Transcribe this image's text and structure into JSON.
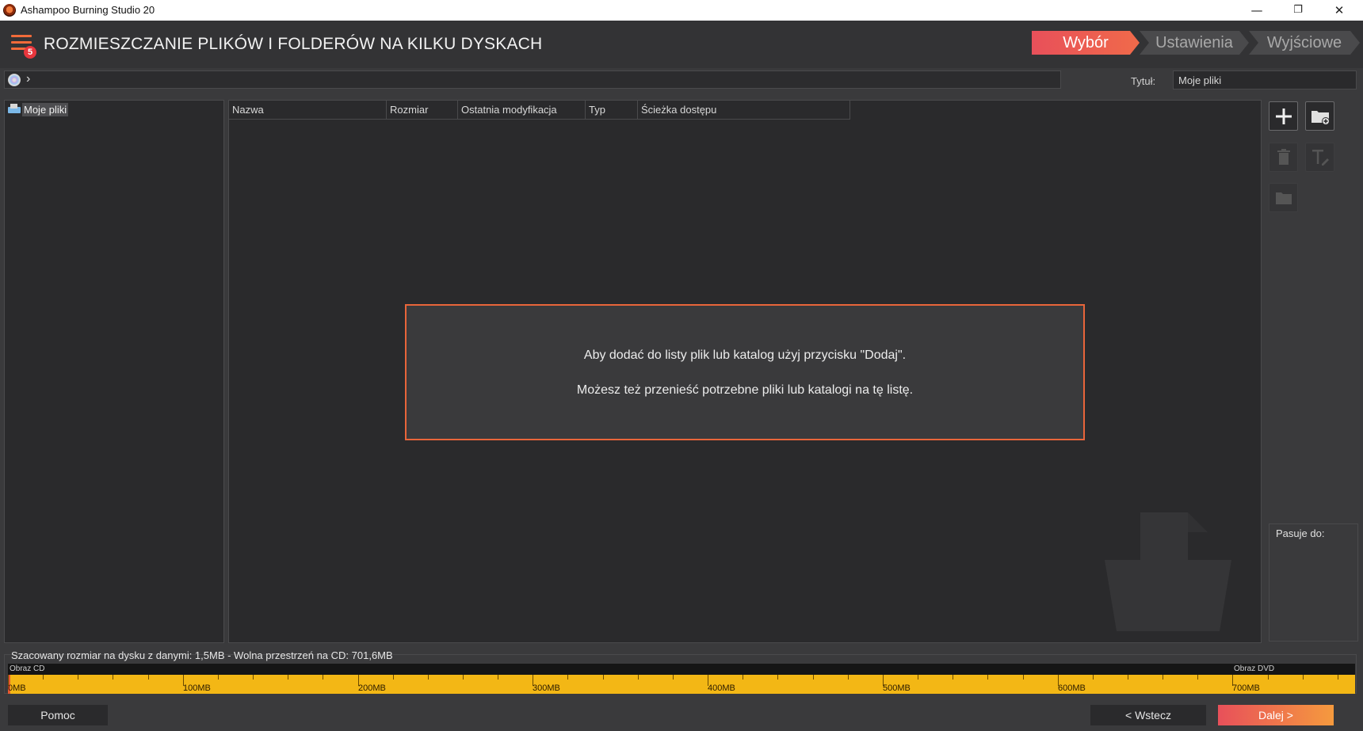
{
  "window": {
    "title": "Ashampoo Burning Studio 20",
    "minimize": "—",
    "maximize": "❐",
    "close": "✕"
  },
  "header": {
    "menu_badge": "5",
    "title": "ROZMIESZCZANIE PLIKÓW I FOLDERÓW NA KILKU DYSKACH",
    "steps": [
      {
        "label": "Wybór",
        "active": true
      },
      {
        "label": "Ustawienia",
        "active": false
      },
      {
        "label": "Wyjściowe",
        "active": false
      }
    ]
  },
  "pathbar": {
    "chevron": "›",
    "title_label": "Tytuł:",
    "title_value": "Moje pliki"
  },
  "tree": {
    "items": [
      {
        "label": "Moje pliki",
        "icon": "disc-drive-icon"
      }
    ]
  },
  "list": {
    "columns": [
      "Nazwa",
      "Rozmiar",
      "Ostatnia modyfikacja",
      "Typ",
      "Ścieżka dostępu"
    ],
    "rows": [],
    "hint_line1": "Aby dodać do listy plik lub katalog użyj przycisku \"Dodaj\".",
    "hint_line2": "Możesz też przenieść potrzebne pliki lub katalogi na tę listę."
  },
  "tools": {
    "icons": [
      "plus-icon",
      "add-folder-icon",
      "trash-icon",
      "rename-icon",
      "new-folder-icon"
    ],
    "fits_label": "Pasuje do:"
  },
  "capacity": {
    "status": "Szacowany rozmiar na dysku z danymi: 1,5MB - Wolna przestrzeń na CD: 701,6MB",
    "cd_label": "Obraz CD",
    "dvd_label": "Obraz DVD",
    "used_mb": 1.5,
    "max_mb": 770,
    "tick_labels": [
      "0MB",
      "100MB",
      "200MB",
      "300MB",
      "400MB",
      "500MB",
      "600MB",
      "700MB"
    ],
    "colors": {
      "bar": "#f3b715",
      "fill": "#e85a30"
    }
  },
  "buttons": {
    "help": "Pomoc",
    "back": "< Wstecz",
    "next": "Dalej >"
  },
  "accent": "#e8505a"
}
